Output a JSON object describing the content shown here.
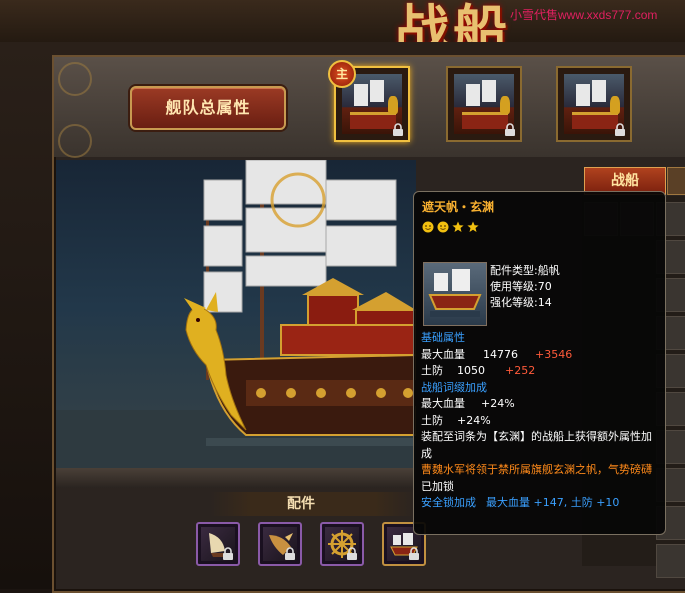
{
  "header": {
    "title_art": "战船",
    "watermark": "小雪代售www.xxds777.com"
  },
  "fleet_button": {
    "label": "舰队总属性"
  },
  "main_badge": "主",
  "ship_slots": [
    {
      "icon": "ship-thumb",
      "locked": true,
      "active": true
    },
    {
      "icon": "ship-thumb",
      "locked": true,
      "active": false
    },
    {
      "icon": "ship-thumb",
      "locked": true,
      "active": false
    }
  ],
  "tabs": {
    "ship": "战船"
  },
  "parts": {
    "label": "配件",
    "slots": [
      {
        "icon": "sail-part-icon",
        "locked": true
      },
      {
        "icon": "bow-part-icon",
        "locked": true
      },
      {
        "icon": "wheel-part-icon",
        "locked": true
      },
      {
        "icon": "hull-part-icon",
        "locked": true
      }
    ]
  },
  "tooltip": {
    "title": "遮天帆・玄渊",
    "stars": [
      "smile",
      "smile",
      "star",
      "star"
    ],
    "type_line": "配件类型:船帆",
    "level_line": "使用等级:70",
    "enhance_line": "强化等级:14",
    "base_header": "基础属性",
    "base_stats": [
      {
        "label": "最大血量",
        "value": "14776",
        "bonus": "+3546"
      },
      {
        "label": "土防",
        "value": "1050",
        "bonus": "+252"
      }
    ],
    "affix_header": "战船词缀加成",
    "affix_stats": [
      {
        "label": "最大血量",
        "value": "+24%"
      },
      {
        "label": "土防",
        "value": "+24%"
      }
    ],
    "equip_desc": "装配至词条为【玄渊】的战船上获得额外属性加成",
    "flavor": "曹魏水军将领于禁所属旗舰玄渊之帆，气势磅礴",
    "locked_text": "已加锁",
    "lock_bonus_label": "安全锁加成",
    "lock_bonus_value": "最大血量 +147, 土防 +10"
  },
  "colors": {
    "title": "#f8b030",
    "blue": "#3aa0ff",
    "bonus_red": "#ff5a3a",
    "flavor_orange": "#ff8a1a"
  }
}
